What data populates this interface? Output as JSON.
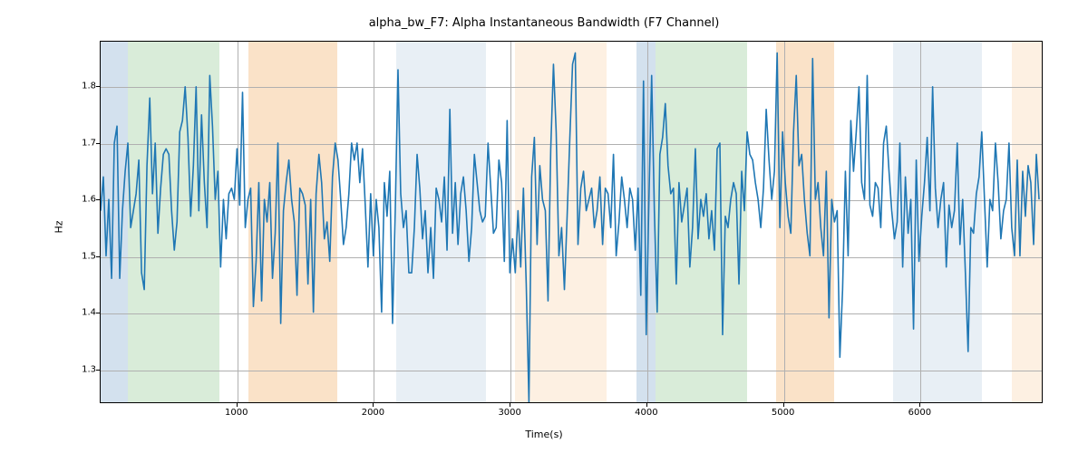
{
  "chart_data": {
    "type": "line",
    "title": "alpha_bw_F7: Alpha Instantaneous Bandwidth (F7 Channel)",
    "xlabel": "Time(s)",
    "ylabel": "Hz",
    "xlim": [
      0,
      6900
    ],
    "ylim": [
      1.24,
      1.88
    ],
    "xticks": [
      1000,
      2000,
      3000,
      4000,
      5000,
      6000
    ],
    "yticks": [
      1.3,
      1.4,
      1.5,
      1.6,
      1.7,
      1.8
    ],
    "grid": true,
    "bands": [
      {
        "x0": 0,
        "x1": 200,
        "color": "#b6cde2",
        "alpha": 0.6
      },
      {
        "x0": 200,
        "x1": 870,
        "color": "#c0e0c0",
        "alpha": 0.6
      },
      {
        "x0": 1080,
        "x1": 1730,
        "color": "#f7cfa3",
        "alpha": 0.6
      },
      {
        "x0": 2160,
        "x1": 2820,
        "color": "#d9e4ef",
        "alpha": 0.6
      },
      {
        "x0": 3030,
        "x1": 3700,
        "color": "#fbe6cf",
        "alpha": 0.6
      },
      {
        "x0": 3920,
        "x1": 4060,
        "color": "#b6cde2",
        "alpha": 0.6
      },
      {
        "x0": 4060,
        "x1": 4730,
        "color": "#c0e0c0",
        "alpha": 0.6
      },
      {
        "x0": 4940,
        "x1": 5370,
        "color": "#f7cfa3",
        "alpha": 0.6
      },
      {
        "x0": 5800,
        "x1": 6450,
        "color": "#d9e4ef",
        "alpha": 0.6
      },
      {
        "x0": 6670,
        "x1": 6900,
        "color": "#fbe6cf",
        "alpha": 0.6
      }
    ],
    "series": [
      {
        "name": "alpha_bw_F7",
        "color": "#1f77b4",
        "x_start": 0,
        "x_step": 20,
        "values": [
          1.58,
          1.64,
          1.5,
          1.6,
          1.46,
          1.7,
          1.73,
          1.46,
          1.58,
          1.65,
          1.7,
          1.55,
          1.58,
          1.61,
          1.67,
          1.47,
          1.44,
          1.66,
          1.78,
          1.61,
          1.7,
          1.54,
          1.62,
          1.68,
          1.69,
          1.68,
          1.58,
          1.51,
          1.56,
          1.72,
          1.74,
          1.8,
          1.71,
          1.57,
          1.66,
          1.8,
          1.58,
          1.75,
          1.63,
          1.55,
          1.82,
          1.73,
          1.6,
          1.65,
          1.48,
          1.6,
          1.53,
          1.61,
          1.62,
          1.6,
          1.69,
          1.59,
          1.79,
          1.55,
          1.6,
          1.62,
          1.41,
          1.49,
          1.63,
          1.42,
          1.6,
          1.56,
          1.63,
          1.46,
          1.54,
          1.7,
          1.38,
          1.58,
          1.63,
          1.67,
          1.6,
          1.56,
          1.43,
          1.62,
          1.61,
          1.59,
          1.45,
          1.6,
          1.4,
          1.61,
          1.68,
          1.63,
          1.53,
          1.56,
          1.49,
          1.64,
          1.7,
          1.67,
          1.6,
          1.52,
          1.55,
          1.61,
          1.7,
          1.67,
          1.7,
          1.63,
          1.69,
          1.59,
          1.48,
          1.61,
          1.5,
          1.6,
          1.55,
          1.4,
          1.63,
          1.57,
          1.65,
          1.38,
          1.58,
          1.83,
          1.61,
          1.55,
          1.58,
          1.47,
          1.47,
          1.55,
          1.68,
          1.62,
          1.53,
          1.58,
          1.47,
          1.55,
          1.46,
          1.62,
          1.6,
          1.56,
          1.64,
          1.51,
          1.76,
          1.54,
          1.63,
          1.52,
          1.61,
          1.64,
          1.58,
          1.49,
          1.55,
          1.68,
          1.63,
          1.58,
          1.56,
          1.57,
          1.7,
          1.62,
          1.54,
          1.55,
          1.67,
          1.63,
          1.49,
          1.74,
          1.47,
          1.53,
          1.47,
          1.58,
          1.48,
          1.62,
          1.45,
          1.24,
          1.64,
          1.71,
          1.52,
          1.66,
          1.6,
          1.58,
          1.42,
          1.69,
          1.84,
          1.72,
          1.5,
          1.55,
          1.44,
          1.57,
          1.71,
          1.84,
          1.86,
          1.52,
          1.62,
          1.65,
          1.58,
          1.6,
          1.62,
          1.55,
          1.58,
          1.64,
          1.52,
          1.62,
          1.61,
          1.55,
          1.68,
          1.5,
          1.56,
          1.64,
          1.6,
          1.55,
          1.62,
          1.6,
          1.51,
          1.62,
          1.43,
          1.81,
          1.36,
          1.6,
          1.82,
          1.58,
          1.4,
          1.68,
          1.71,
          1.77,
          1.66,
          1.61,
          1.62,
          1.45,
          1.63,
          1.56,
          1.59,
          1.62,
          1.48,
          1.55,
          1.69,
          1.53,
          1.6,
          1.57,
          1.61,
          1.53,
          1.58,
          1.51,
          1.69,
          1.7,
          1.36,
          1.57,
          1.55,
          1.6,
          1.63,
          1.61,
          1.45,
          1.65,
          1.58,
          1.72,
          1.68,
          1.67,
          1.63,
          1.6,
          1.55,
          1.62,
          1.76,
          1.67,
          1.6,
          1.65,
          1.86,
          1.55,
          1.72,
          1.63,
          1.57,
          1.54,
          1.72,
          1.82,
          1.66,
          1.68,
          1.6,
          1.54,
          1.5,
          1.85,
          1.6,
          1.63,
          1.55,
          1.5,
          1.65,
          1.39,
          1.6,
          1.56,
          1.58,
          1.32,
          1.44,
          1.65,
          1.5,
          1.74,
          1.65,
          1.72,
          1.8,
          1.63,
          1.6,
          1.82,
          1.59,
          1.57,
          1.63,
          1.62,
          1.55,
          1.7,
          1.73,
          1.65,
          1.58,
          1.53,
          1.56,
          1.7,
          1.48,
          1.64,
          1.54,
          1.6,
          1.37,
          1.67,
          1.49,
          1.57,
          1.63,
          1.71,
          1.58,
          1.8,
          1.62,
          1.55,
          1.6,
          1.63,
          1.48,
          1.59,
          1.55,
          1.58,
          1.7,
          1.52,
          1.6,
          1.47,
          1.33,
          1.55,
          1.54,
          1.61,
          1.64,
          1.72,
          1.6,
          1.48,
          1.6,
          1.58,
          1.7,
          1.63,
          1.53,
          1.58,
          1.6,
          1.7,
          1.55,
          1.5,
          1.67,
          1.5,
          1.65,
          1.57,
          1.66,
          1.63,
          1.52,
          1.68,
          1.6
        ]
      }
    ]
  }
}
